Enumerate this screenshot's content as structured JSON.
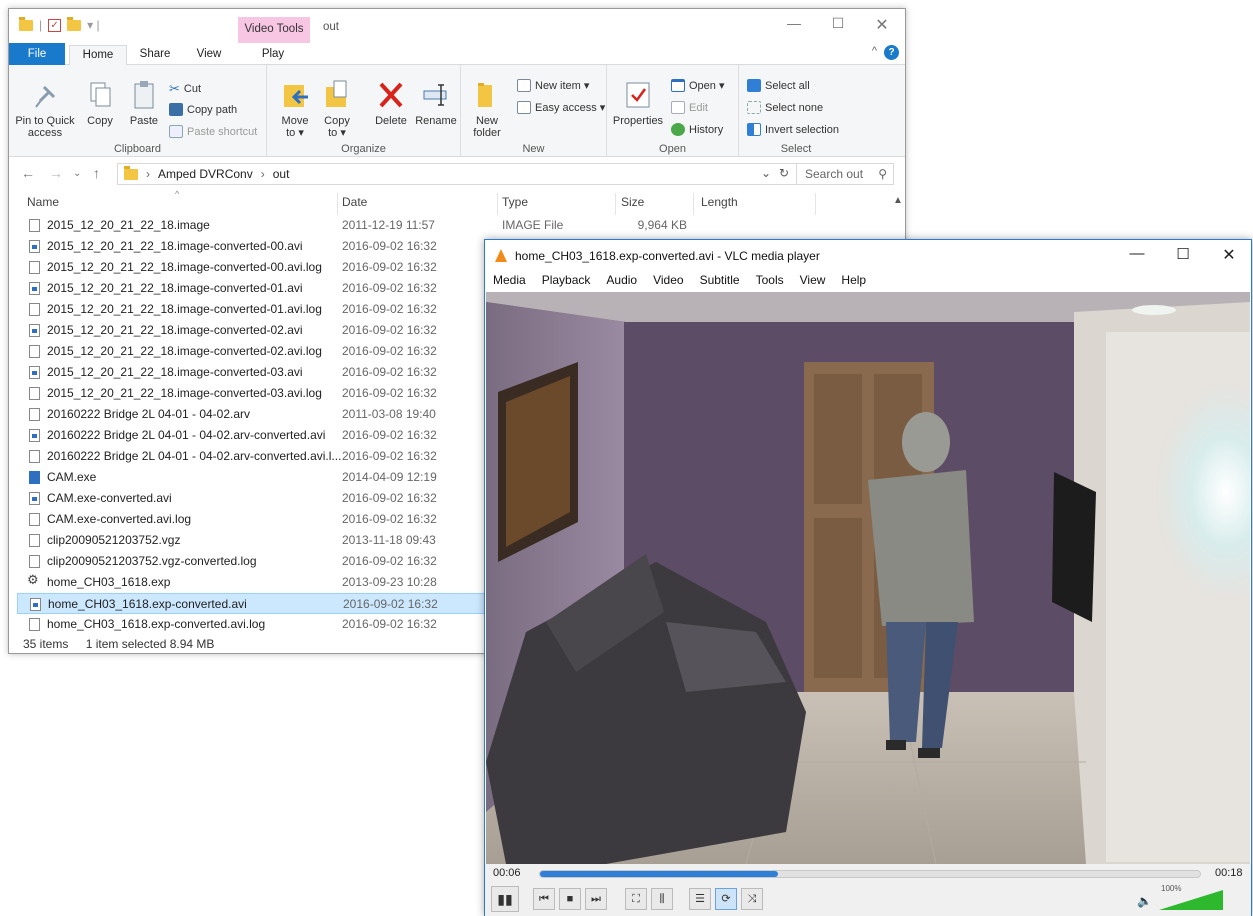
{
  "explorer": {
    "context_tab": "Video Tools",
    "window_title": "out",
    "tabs": {
      "file": "File",
      "home": "Home",
      "share": "Share",
      "view": "View",
      "play": "Play"
    },
    "clipboard": {
      "pin": "Pin to Quick access",
      "copy": "Copy",
      "paste": "Paste",
      "cut": "Cut",
      "copy_path": "Copy path",
      "paste_shortcut": "Paste shortcut",
      "label": "Clipboard"
    },
    "organize": {
      "move_to": "Move to ▾",
      "copy_to": "Copy to ▾",
      "delete": "Delete",
      "rename": "Rename",
      "label": "Organize"
    },
    "new": {
      "new_folder": "New folder",
      "new_item": "New item ▾",
      "easy_access": "Easy access ▾",
      "label": "New"
    },
    "open": {
      "properties": "Properties",
      "open": "Open ▾",
      "edit": "Edit",
      "history": "History",
      "label": "Open"
    },
    "select": {
      "select_all": "Select all",
      "select_none": "Select none",
      "invert": "Invert selection",
      "label": "Select"
    },
    "address": {
      "crumb1": "Amped DVRConv",
      "crumb2": "out",
      "search_placeholder": "Search out"
    },
    "columns": {
      "name": "Name",
      "date": "Date",
      "type": "Type",
      "size": "Size",
      "length": "Length"
    },
    "files": [
      {
        "name": "2015_12_20_21_22_18.image",
        "date": "2011-12-19 11:57",
        "type": "IMAGE File",
        "size": "9,964 KB",
        "icon": "file"
      },
      {
        "name": "2015_12_20_21_22_18.image-converted-00.avi",
        "date": "2016-09-02 16:32",
        "type": "",
        "size": "",
        "icon": "avi"
      },
      {
        "name": "2015_12_20_21_22_18.image-converted-00.avi.log",
        "date": "2016-09-02 16:32",
        "type": "",
        "size": "",
        "icon": "file"
      },
      {
        "name": "2015_12_20_21_22_18.image-converted-01.avi",
        "date": "2016-09-02 16:32",
        "type": "",
        "size": "",
        "icon": "avi"
      },
      {
        "name": "2015_12_20_21_22_18.image-converted-01.avi.log",
        "date": "2016-09-02 16:32",
        "type": "",
        "size": "",
        "icon": "file"
      },
      {
        "name": "2015_12_20_21_22_18.image-converted-02.avi",
        "date": "2016-09-02 16:32",
        "type": "",
        "size": "",
        "icon": "avi"
      },
      {
        "name": "2015_12_20_21_22_18.image-converted-02.avi.log",
        "date": "2016-09-02 16:32",
        "type": "",
        "size": "",
        "icon": "file"
      },
      {
        "name": "2015_12_20_21_22_18.image-converted-03.avi",
        "date": "2016-09-02 16:32",
        "type": "",
        "size": "",
        "icon": "avi"
      },
      {
        "name": "2015_12_20_21_22_18.image-converted-03.avi.log",
        "date": "2016-09-02 16:32",
        "type": "",
        "size": "",
        "icon": "file"
      },
      {
        "name": "20160222 Bridge 2L 04-01 - 04-02.arv",
        "date": "2011-03-08 19:40",
        "type": "",
        "size": "",
        "icon": "file"
      },
      {
        "name": "20160222 Bridge 2L 04-01 - 04-02.arv-converted.avi",
        "date": "2016-09-02 16:32",
        "type": "",
        "size": "",
        "icon": "avi"
      },
      {
        "name": "20160222 Bridge 2L 04-01 - 04-02.arv-converted.avi.l...",
        "date": "2016-09-02 16:32",
        "type": "",
        "size": "",
        "icon": "file"
      },
      {
        "name": "CAM.exe",
        "date": "2014-04-09 12:19",
        "type": "",
        "size": "",
        "icon": "exe"
      },
      {
        "name": "CAM.exe-converted.avi",
        "date": "2016-09-02 16:32",
        "type": "",
        "size": "",
        "icon": "avi"
      },
      {
        "name": "CAM.exe-converted.avi.log",
        "date": "2016-09-02 16:32",
        "type": "",
        "size": "",
        "icon": "file"
      },
      {
        "name": "clip20090521203752.vgz",
        "date": "2013-11-18 09:43",
        "type": "",
        "size": "",
        "icon": "file"
      },
      {
        "name": "clip20090521203752.vgz-converted.log",
        "date": "2016-09-02 16:32",
        "type": "",
        "size": "",
        "icon": "file"
      },
      {
        "name": "home_CH03_1618.exp",
        "date": "2013-09-23 10:28",
        "type": "",
        "size": "",
        "icon": "bin"
      },
      {
        "name": "home_CH03_1618.exp-converted.avi",
        "date": "2016-09-02 16:32",
        "type": "",
        "size": "",
        "icon": "avi",
        "selected": true
      },
      {
        "name": "home_CH03_1618.exp-converted.avi.log",
        "date": "2016-09-02 16:32",
        "type": "",
        "size": "",
        "icon": "file"
      }
    ],
    "status": {
      "count": "35 items",
      "selection": "1 item selected  8.94 MB"
    }
  },
  "vlc": {
    "title": "home_CH03_1618.exp-converted.avi - VLC media player",
    "menu": [
      "Media",
      "Playback",
      "Audio",
      "Video",
      "Subtitle",
      "Tools",
      "View",
      "Help"
    ],
    "time_elapsed": "00:06",
    "time_total": "00:18",
    "progress": 0.36,
    "volume_label": "100%",
    "volume": 1.0
  },
  "colors": {
    "accent": "#1979ca",
    "selection": "#cce8ff",
    "vlc_progress": "#2f7fd6",
    "volume": "#2eb82e",
    "video_tools": "#f7c6e3"
  }
}
